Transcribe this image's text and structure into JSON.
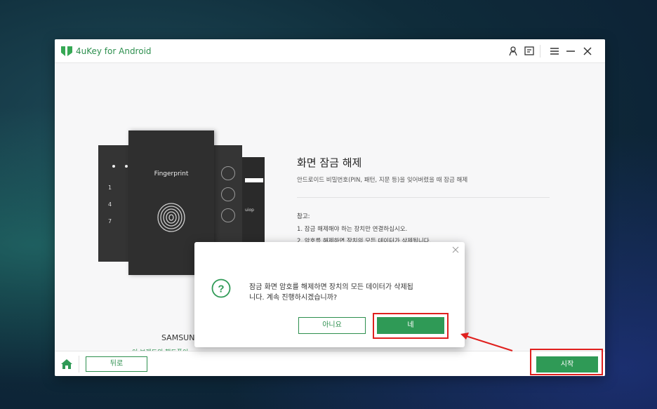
{
  "app": {
    "title": "4uKey for Android"
  },
  "titlebar_icons": [
    "user-icon",
    "feedback-icon",
    "menu-icon",
    "minimize-icon",
    "close-icon"
  ],
  "phones": {
    "fingerprint_label": "Fingerprint",
    "keypad": [
      "1",
      "4",
      "7"
    ],
    "pattern_text": "uiop",
    "device_label": "SAMSUN",
    "brand_link": "이 브랜드의 핸드폰이"
  },
  "main": {
    "title": "화면 잠금 해제",
    "subtitle": "안드로이드 비밀번호(PIN, 패턴, 지문 등)을 잊어버렸을 때 잠금 해제",
    "note_label": "참고:",
    "notes": [
      "1. 잠금 해제해야 하는 장치만 연결하십시오.",
      "2. 암호를 해제하면 장치의 모든 데이터가 삭제됩니다."
    ]
  },
  "footer": {
    "back_label": "뒤로",
    "start_label": "시작"
  },
  "dialog": {
    "message_line1": "잠금 화면 암호를 해제하면 장치의 모든 데이터가 삭제됩",
    "message_line2": "니다. 계속 진행하시겠습니까?",
    "no_label": "아니요",
    "yes_label": "네"
  },
  "colors": {
    "accent": "#2f9a56",
    "highlight": "#e0201e"
  }
}
